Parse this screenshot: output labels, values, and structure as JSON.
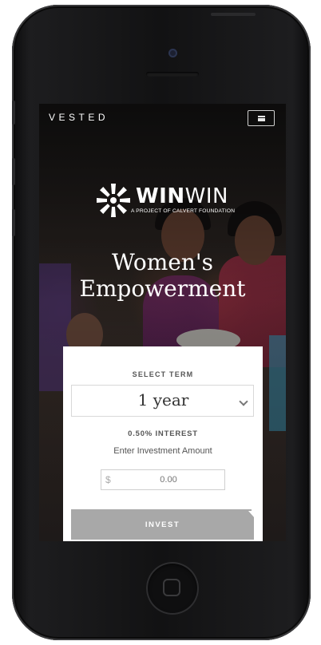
{
  "header": {
    "brand": "VESTED",
    "menu_icon": "hamburger-menu-icon"
  },
  "logo": {
    "word_bold": "WIN",
    "word_regular": "WIN",
    "tagline": "A PROJECT OF CALVERT FOUNDATION",
    "icon": "starburst-logo-icon"
  },
  "hero": {
    "line1": "Women's",
    "line2": "Empowerment"
  },
  "investment_card": {
    "select_term_label": "SELECT TERM",
    "term_value": "1 year",
    "interest": "0.50% INTEREST",
    "amount_label": "Enter Investment Amount",
    "currency_symbol": "$",
    "amount_placeholder": "0.00",
    "invest_button": "INVEST"
  }
}
